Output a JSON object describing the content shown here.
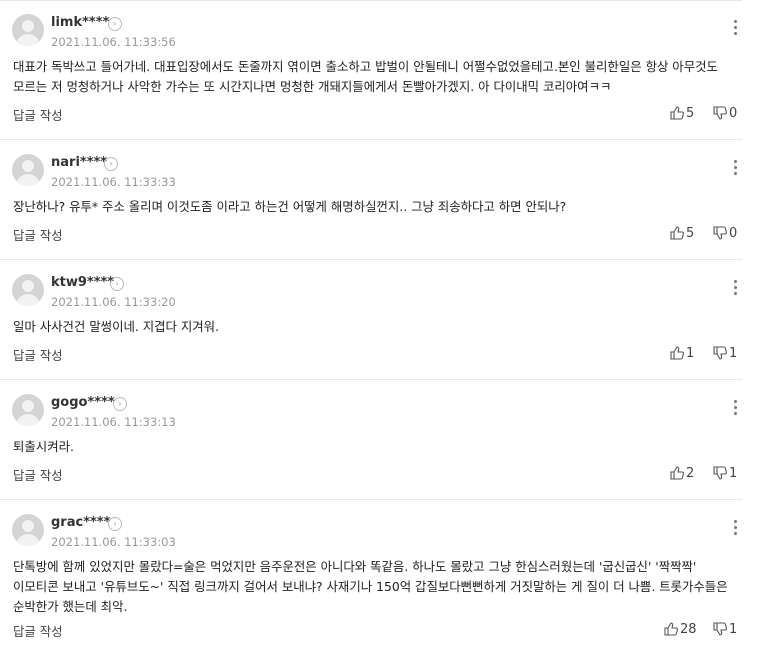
{
  "comments": [
    {
      "username": "limk****",
      "timestamp": "2021.11.06. 11:33:56",
      "body": "대표가 독박쓰고 들어가네. 대표입장에서도 돈줄까지 엮이면 출소하고 밥벌이 안될테니 어쩔수없었을테고.본인 불리한일은 항상 아무것도 모르는 저 멍청하거나 사악한 가수는 또 시간지나면 멍청한 개돼지들에게서 돈빨아가겠지. 아 다이내믹 코리아여ㅋㅋ",
      "reply_label": "답글 작성",
      "likes": "5",
      "dislikes": "0"
    },
    {
      "username": "nari****",
      "timestamp": "2021.11.06. 11:33:33",
      "body": "장난하나? 유투* 주소 올리며 이것도좀 이라고 하는건 어떻게 해명하실껀지.. 그냥 죄송하다고 하면 안되나?",
      "reply_label": "답글 작성",
      "likes": "5",
      "dislikes": "0"
    },
    {
      "username": "ktw9****",
      "timestamp": "2021.11.06. 11:33:20",
      "body": "일마 사사건건 말썽이네. 지겹다 지겨워.",
      "reply_label": "답글 작성",
      "likes": "1",
      "dislikes": "1"
    },
    {
      "username": "gogo****",
      "timestamp": "2021.11.06. 11:33:13",
      "body": "퇴출시켜라.",
      "reply_label": "답글 작성",
      "likes": "2",
      "dislikes": "1"
    },
    {
      "username": "grac****",
      "timestamp": "2021.11.06. 11:33:03",
      "body": "단톡방에 함께 있었지만 몰랐다=술은 먹었지만 음주운전은 아니다와 똑같음. 하나도 몰랐고 그냥 한심스러웠는데 '굽신굽신' '짝짝짝' 이모티콘 보내고 '유튜브도~' 직접 링크까지 걸어서 보내냐? 사재기나 150억 갑질보다뻔뻔하게 거짓말하는 게 질이 더 나쁨. 트롯가수들은 순박한가 했는데 최악.",
      "reply_label": "답글 작성",
      "likes": "28",
      "dislikes": "1"
    }
  ]
}
